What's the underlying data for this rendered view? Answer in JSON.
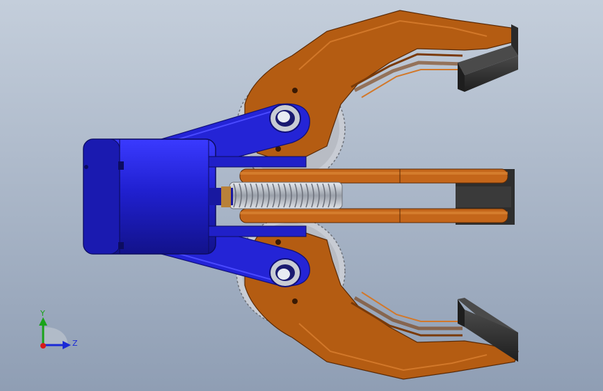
{
  "viewport": {
    "background_top": "#c4cedb",
    "background_bottom": "#8f9eb4"
  },
  "model": {
    "colors": {
      "jaw": "#b45c12",
      "jaw_dark": "#7a3a08",
      "jaw_light": "#d2782a",
      "motor": "#2424d6",
      "motor_dark": "#10107a",
      "motor_light": "#4a4aff",
      "gear": "#c8ccd4",
      "gear_dark": "#6c7078",
      "pad": "#2e2e2e",
      "pad_light": "#4a4a4a"
    }
  },
  "triad": {
    "y_label": "Y",
    "z_label": "Z",
    "colors": {
      "y": "#1aa31a",
      "z": "#1a2ad6",
      "x": "#d61a1a"
    }
  }
}
